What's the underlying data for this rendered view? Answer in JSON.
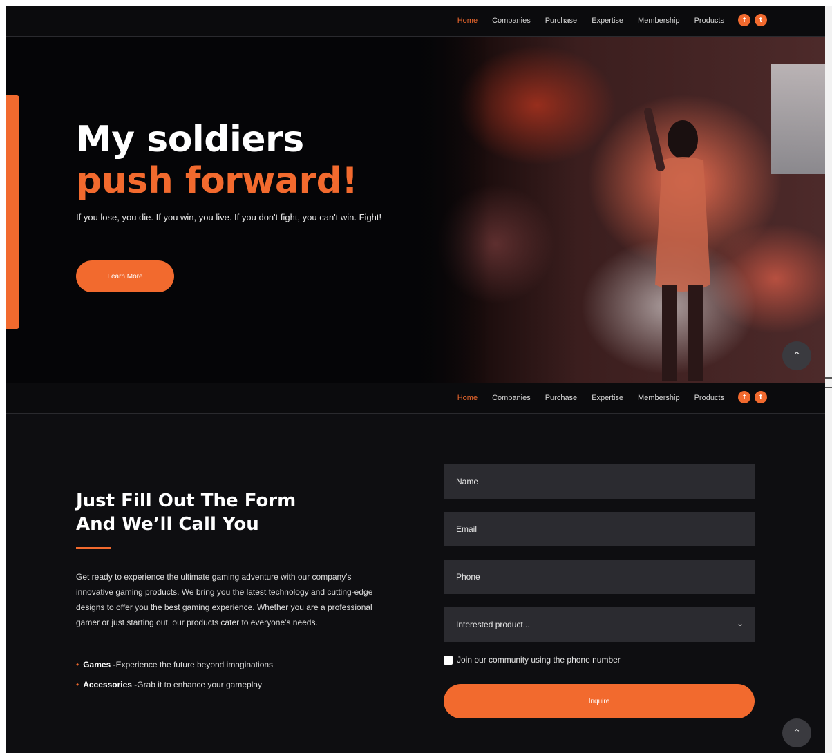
{
  "nav": {
    "items": [
      "Home",
      "Companies",
      "Purchase",
      "Expertise",
      "Membership",
      "Products"
    ],
    "active": "Home",
    "social": [
      {
        "icon": "facebook-icon",
        "glyph": "f"
      },
      {
        "icon": "twitter-icon",
        "glyph": "t"
      }
    ]
  },
  "hero": {
    "title_line1": "My soldiers",
    "title_line2": "push forward!",
    "subtitle": "If you lose, you die. If you win, you live. If you don't fight, you can't win. Fight!",
    "button": "Learn More"
  },
  "form_section": {
    "title_line1": "Just Fill Out The Form",
    "title_line2": "And We’ll Call You",
    "description": "Get ready to experience the ultimate gaming adventure with our company's innovative gaming products. We bring you the latest technology and cutting-edge designs to offer you the best gaming experience. Whether you are a professional gamer or just starting out, our products cater to everyone's needs.",
    "bullets": [
      {
        "bold": "Games",
        "text": "-Experience the future beyond imaginations"
      },
      {
        "bold": "Accessories",
        "text": "-Grab it to enhance your gameplay"
      }
    ],
    "fields": {
      "name": "Name",
      "email": "Email",
      "phone": "Phone",
      "product": "Interested product..."
    },
    "checkbox_label": "Join our community using the phone number",
    "submit": "Inquire"
  },
  "icons": {
    "scroll_top": "chevron-up-icon",
    "select_chevron": "chevron-down-icon"
  },
  "colors": {
    "accent": "#f26a2e",
    "background": "#0b0b0d",
    "field": "#2b2b30"
  }
}
